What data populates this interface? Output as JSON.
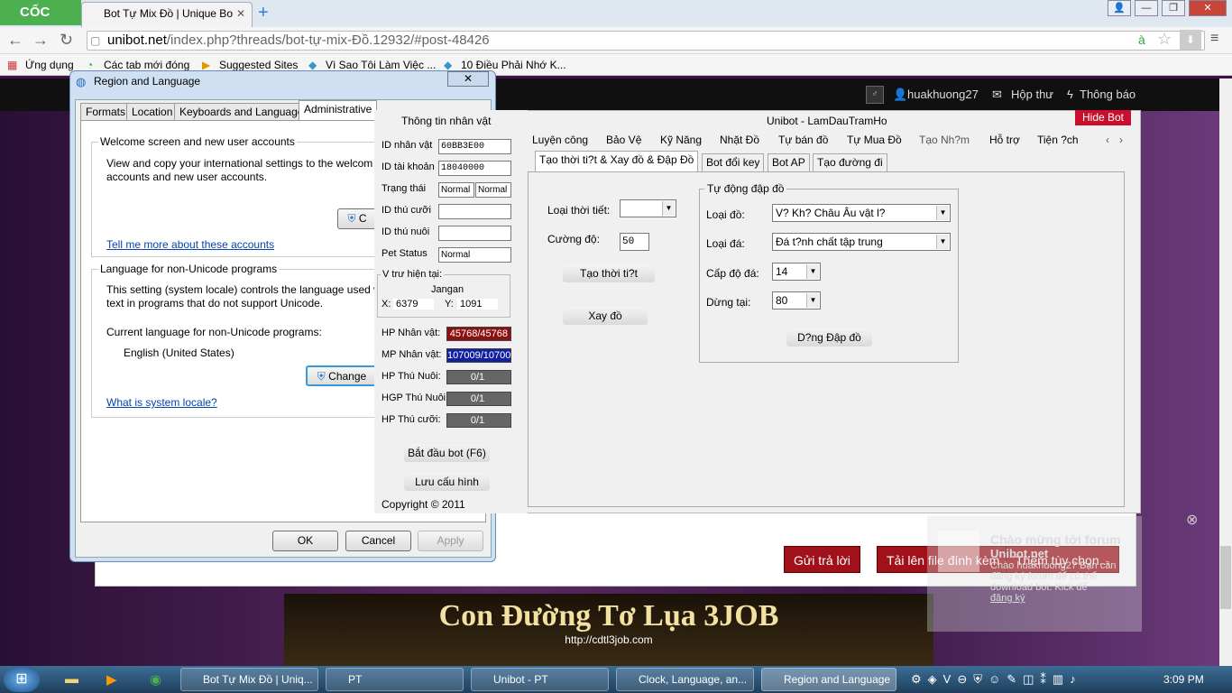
{
  "browser": {
    "logo": "CỐC CỐC",
    "tab_title": "Bot Tự Mix Đồ | Unique Bo",
    "url_prefix": "unibot.net",
    "url_rest": "/index.php?threads/bot-tự-mix-Đồ.12932/#post-48426",
    "bookmarks": [
      "Ứng dụng",
      "Các tab mới đóng",
      "Suggested Sites",
      "Vì Sao Tôi Làm Việc ...",
      "10 Điều Phải Nhớ K..."
    ]
  },
  "forum": {
    "username": "huakhuong27",
    "inbox": "Hộp thư",
    "alerts": "Thông báo",
    "reply_button": "Gửi trả lời",
    "upload_button": "Tải lên file đính kèm",
    "more_button": "Thêm tùy chọn...",
    "banner_title": "Con Đường Tơ Lụa 3JOB",
    "banner_url": "http://cdtl3job.com",
    "notif_title": "Chào mừng tới forum",
    "notif_sub": "Unibot.net",
    "notif_text": "Chào huakhuong27 Bạn cần đăng ký forum để có thể download bot. Kick để",
    "notif_link": "đăng ký"
  },
  "region_dialog": {
    "title": "Region and Language",
    "tabs": [
      "Formats",
      "Location",
      "Keyboards and Languages",
      "Administrative"
    ],
    "welcome_heading": "Welcome screen and new user accounts",
    "welcome_text1": "View and copy your international settings to the welcom",
    "welcome_text2": "accounts and new user accounts.",
    "copy_btn": "C",
    "tell_more": "Tell me more about these accounts",
    "unicode_heading": "Language for non-Unicode programs",
    "unicode_text1": "This setting (system locale) controls the language used w",
    "unicode_text2": "text in programs that do not support Unicode.",
    "current_label": "Current language for non-Unicode programs:",
    "current_value": "English (United States)",
    "change_btn": "Change",
    "what_is": "What is system locale?",
    "ok": "OK",
    "cancel": "Cancel",
    "apply": "Apply"
  },
  "unibot": {
    "left_title": "Thông tin nhân vật",
    "window_title": "Unibot - LamDauTramHo",
    "hide_bot": "Hide Bot",
    "fields": [
      {
        "label": "ID nhân vật",
        "value": "60BB3E00"
      },
      {
        "label": "ID tài khoản",
        "value": "18040000"
      },
      {
        "label": "Trạng thái",
        "value": "Normal",
        "value2": "Normal"
      },
      {
        "label": "ID thú cưỡi",
        "value": ""
      },
      {
        "label": "ID thú nuôi",
        "value": ""
      },
      {
        "label": "Pet Status",
        "value": "Normal"
      }
    ],
    "position_label": "V trư hiện tại:",
    "location": "Jangan",
    "x_label": "X:",
    "x_value": "6379",
    "y_label": "Y:",
    "y_value": "1091",
    "bars": [
      {
        "label": "HP Nhân vật:",
        "value": "45768/45768",
        "color": "#8b1010"
      },
      {
        "label": "MP Nhân vật:",
        "value": "107009/10700",
        "color": "#1020a0"
      },
      {
        "label": "HP Thú Nuôi:",
        "value": "0/1",
        "color": "#666"
      },
      {
        "label": "HGP Thú Nuôi:",
        "value": "0/1",
        "color": "#666"
      },
      {
        "label": "HP Thú cưỡi:",
        "value": "0/1",
        "color": "#666"
      }
    ],
    "start_btn": "Bắt đầu bot (F6)",
    "save_btn": "Lưu cấu hình",
    "copyright": "Copyright © 2011",
    "menu": [
      "Luyện công",
      "Bảo Vệ",
      "Kỹ Năng",
      "Nhặt Đồ",
      "Tự bán đồ",
      "Tự Mua Đồ",
      "Tạo Nh?m",
      "Hỗ trợ",
      "Tiện ?ch"
    ],
    "subtabs": [
      "Tạo thời ti?t & Xay đồ & Đập Đồ",
      "Bot đổi key",
      "Bot AP",
      "Tạo đường đi"
    ],
    "weather_label": "Loại thời tiết:",
    "weather_value": "",
    "strength_label": "Cường độ:",
    "strength_value": "50",
    "create_weather_btn": "Tạo thời ti?t",
    "grind_btn": "Xay đồ",
    "auto_group": "Tự động đập đồ",
    "item_type_label": "Loại đồ:",
    "item_type_value": "V? Kh? Châu Âu vật l?",
    "stone_type_label": "Loại đá:",
    "stone_type_value": "Đá t?nh chất tập trung",
    "stone_level_label": "Cấp độ đá:",
    "stone_level_value": "14",
    "stop_label": "Dừng tại:",
    "stop_value": "80",
    "stop_btn": "D?ng Đập đồ"
  },
  "taskbar": {
    "items": [
      "Bot Tự Mix Đồ | Uniq...",
      "PT",
      "Unibot - PT",
      "Clock, Language, an...",
      "Region and Language"
    ],
    "time": "3:09 PM"
  }
}
